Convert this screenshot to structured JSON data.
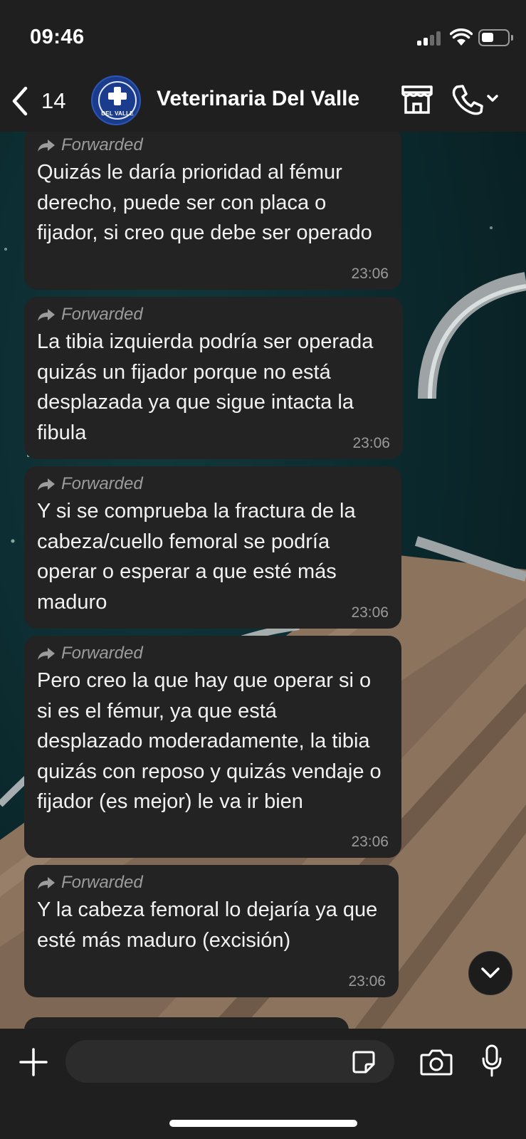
{
  "status_bar": {
    "time": "09:46"
  },
  "header": {
    "back_count": "14",
    "contact_name": "Veterinaria Del Valle",
    "avatar_text": "DEL VALLE"
  },
  "messages": [
    {
      "forwarded_label": "Forwarded",
      "text": "Quizás le daría prioridad al fémur derecho, puede ser con placa o fijador, si creo que debe ser operado",
      "time": "23:06"
    },
    {
      "forwarded_label": "Forwarded",
      "text": "La tibia izquierda podría ser operada quizás un fijador porque no está desplazada ya que sigue intacta la fibula",
      "time": "23:06"
    },
    {
      "forwarded_label": "Forwarded",
      "text": "Y si se comprueba la fractura de la cabeza/cuello femoral se podría operar o esperar a que esté más maduro",
      "time": "23:06"
    },
    {
      "forwarded_label": "Forwarded",
      "text": "Pero creo la que hay que operar si o si es el fémur, ya que está desplazado moderadamente, la tibia quizás con reposo y quizás vendaje o fijador (es mejor) le va ir bien",
      "time": "23:06"
    },
    {
      "forwarded_label": "Forwarded",
      "text": "Y la cabeza femoral lo dejaría ya que esté más maduro (excisión)",
      "time": "23:06"
    }
  ],
  "composer": {
    "value": "",
    "placeholder": ""
  },
  "icons": {
    "back": "chevron-left-icon",
    "store": "storefront-icon",
    "call": "phone-icon",
    "forwarded": "forward-arrow-icon",
    "scroll_down": "chevron-down-icon",
    "attach": "plus-icon",
    "sticker": "sticker-icon",
    "camera": "camera-icon",
    "mic": "microphone-icon"
  },
  "colors": {
    "bar_background": "#1f1f1f",
    "bubble_background": "#232323",
    "muted_text": "#9c9c9c"
  }
}
